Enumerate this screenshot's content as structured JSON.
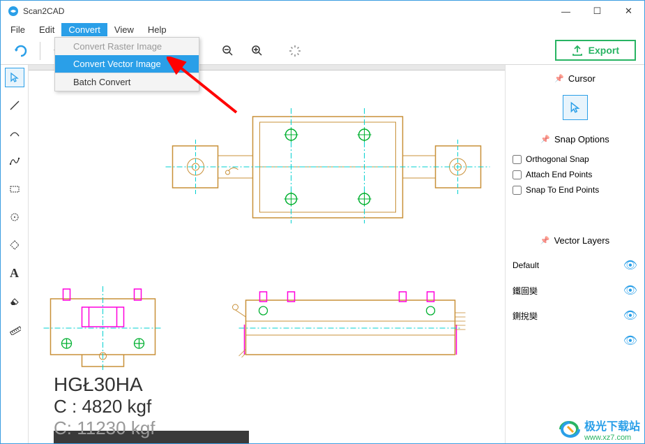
{
  "app": {
    "title": "Scan2CAD"
  },
  "window_controls": {
    "min": "—",
    "max": "☐",
    "close": "✕"
  },
  "menu": {
    "items": [
      "File",
      "Edit",
      "Convert",
      "View",
      "Help"
    ],
    "active_index": 2
  },
  "dropdown": {
    "items": [
      {
        "label": "Convert Raster Image",
        "state": "disabled"
      },
      {
        "label": "Convert Vector Image",
        "state": "highlighted"
      },
      {
        "label": "Batch Convert",
        "state": "normal"
      }
    ]
  },
  "toolbar": {
    "export_label": "Export"
  },
  "right": {
    "cursor_title": "Cursor",
    "snap_title": "Snap Options",
    "snap_options": [
      {
        "label": "Orthogonal Snap",
        "checked": false
      },
      {
        "label": "Attach End Points",
        "checked": false
      },
      {
        "label": "Snap To End Points",
        "checked": false
      }
    ],
    "layers_title": "Vector Layers",
    "layers": [
      {
        "name": "Default"
      },
      {
        "name": "鐵囼奱"
      },
      {
        "name": "鍘挩奱"
      },
      {
        "name": ""
      }
    ]
  },
  "canvas_text": {
    "line1": "HGŁ30HA",
    "line2": "C : 4820 kgf",
    "line3": "C: 11230 kgf"
  },
  "watermark": {
    "name": "极光下载站",
    "url": "www.xz7.com"
  },
  "colors": {
    "accent": "#2a9fe8",
    "export_green": "#28b463",
    "brown": "#c89038",
    "cyan": "#00d0d0",
    "green": "#00b030",
    "magenta": "#ff00dd"
  }
}
